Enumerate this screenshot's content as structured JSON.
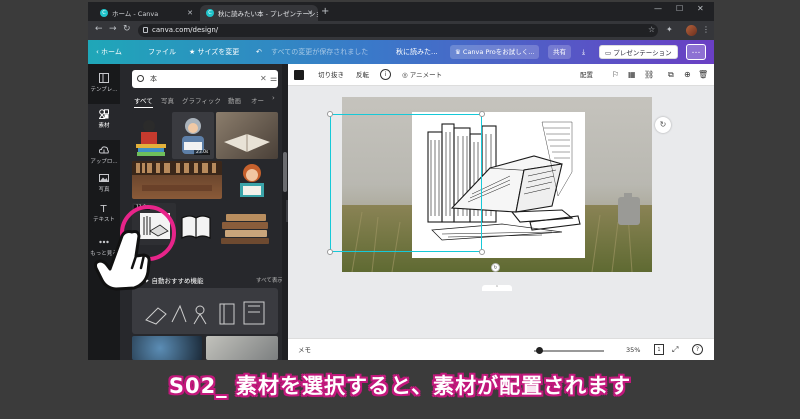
{
  "browser": {
    "tabs": [
      {
        "label": "ホーム - Canva",
        "favicon": "C"
      },
      {
        "label": "秋に読みたい本 - プレゼンテーショ",
        "favicon": "C"
      }
    ],
    "url": "canva.com/design/",
    "window_controls": {
      "minimize": "—",
      "maximize": "☐",
      "close": "✕"
    }
  },
  "canva_header": {
    "home": "ホーム",
    "file": "ファイル",
    "resize": "サイズを変更",
    "saved_status": "すべての変更が保存されました",
    "doc_title": "秋に読みた...",
    "try_pro": "Canva Proをお試しく...",
    "share": "共有",
    "present": "プレゼンテーション",
    "more": "…"
  },
  "rail": [
    {
      "label": "テンプレ..."
    },
    {
      "label": "素材"
    },
    {
      "label": "アップロ..."
    },
    {
      "label": "写真"
    },
    {
      "label": "テキスト"
    },
    {
      "label": "もっと見る"
    }
  ],
  "panel": {
    "search_value": "本",
    "tabs": [
      "すべて",
      "写真",
      "グラフィック",
      "動画",
      "オー"
    ],
    "badges": [
      "23.0s",
      "11.0s"
    ],
    "section_title": "自動おすすめ機能",
    "section_link": "すべて表示"
  },
  "context_bar": {
    "crop": "切り抜き",
    "flip": "反転",
    "animate": "アニメート",
    "position": "配置",
    "info_icon": "i"
  },
  "bottom_bar": {
    "notes": "メモ",
    "zoom": "35%",
    "zoom_fraction": 0.08,
    "help": "?"
  },
  "caption": "S02_ 素材を選択すると、素材が配置されます",
  "colors": {
    "accent": "#16c9d8",
    "caption_outline": "#c2187c",
    "pointer_ring": "#e8248a"
  }
}
